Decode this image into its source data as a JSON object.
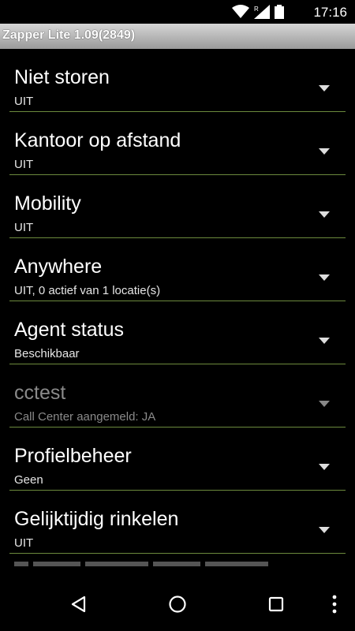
{
  "status_bar": {
    "time": "17:16",
    "icons": [
      "wifi-icon",
      "signal-icon",
      "battery-icon"
    ]
  },
  "app": {
    "title": "Zapper Lite 1.09(2849)"
  },
  "settings": [
    {
      "title": "Niet storen",
      "value": "UIT",
      "enabled": true
    },
    {
      "title": "Kantoor op afstand",
      "value": "UIT",
      "enabled": true
    },
    {
      "title": "Mobility",
      "value": "UIT",
      "enabled": true
    },
    {
      "title": "Anywhere",
      "value": "UIT, 0 actief van 1 locatie(s)",
      "enabled": true
    },
    {
      "title": "Agent status",
      "value": "Beschikbaar",
      "enabled": true
    },
    {
      "title": "cctest",
      "value": "Call Center aangemeld: JA",
      "enabled": false
    },
    {
      "title": "Profielbeheer",
      "value": "Geen",
      "enabled": true
    },
    {
      "title": "Gelijktijdig rinkelen",
      "value": "UIT",
      "enabled": true
    }
  ],
  "nav_bar": {
    "buttons": [
      "back-icon",
      "home-icon",
      "recents-icon",
      "overflow-menu-icon"
    ]
  },
  "colors": {
    "divider": "#6c8a3d",
    "titlebar": "#b0b0b0",
    "background": "#000000"
  }
}
